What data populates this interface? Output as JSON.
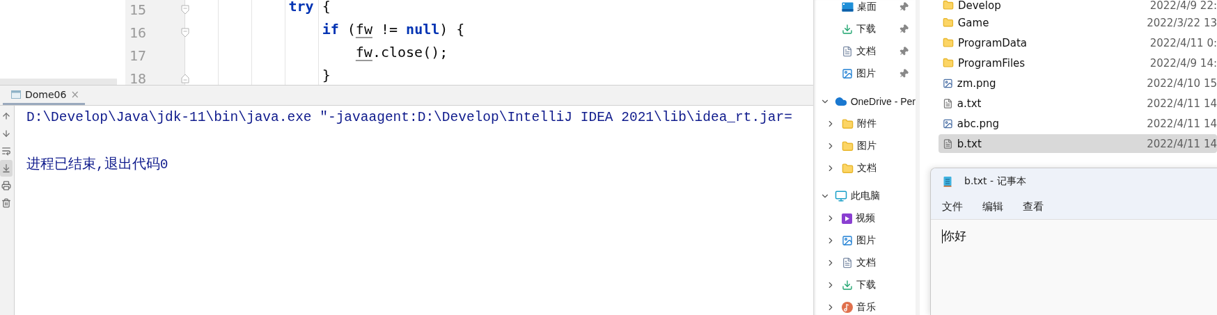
{
  "editor": {
    "lines": [
      {
        "number": "15",
        "kind": "opener",
        "tokens": [
          {
            "text": "try",
            "kind": "keyword"
          },
          {
            "text": " {",
            "kind": "plain"
          }
        ],
        "children": [
          {
            "number": "16",
            "kind": "opener",
            "tokens": [
              {
                "text": "if",
                "kind": "keyword"
              },
              {
                "text": " (",
                "kind": "plain"
              },
              {
                "text": "fw",
                "kind": "variable"
              },
              {
                "text": " != ",
                "kind": "plain"
              },
              {
                "text": "null",
                "kind": "keyword"
              },
              {
                "text": ") {",
                "kind": "plain"
              }
            ],
            "children": [
              {
                "number": "17",
                "tokens": [
                  {
                    "text": "fw",
                    "kind": "variable"
                  },
                  {
                    "text": ".close();",
                    "kind": "plain"
                  }
                ]
              }
            ]
          },
          {
            "number": "18",
            "kind": "closer",
            "tokens": [
              {
                "text": "}",
                "kind": "plain"
              }
            ]
          }
        ]
      }
    ]
  },
  "run_panel": {
    "tab": {
      "label": "Dome06",
      "close": "×",
      "selected": true
    },
    "toolbar": [
      {
        "selected": false
      },
      {
        "selected": false
      },
      {
        "selected": false
      },
      {
        "selected": true
      },
      {
        "selected": false
      },
      {
        "selected": false
      }
    ],
    "command": "D:\\Develop\\Java\\jdk-11\\bin\\java.exe \"-javaagent:D:\\Develop\\IntelliJ IDEA 2021\\lib\\idea_rt.jar=",
    "exit_message": "进程已结束,退出代码0"
  },
  "explorer": {
    "nav": [
      {
        "label": "桌面",
        "pinned": true
      },
      {
        "label": "下载",
        "pinned": true
      },
      {
        "label": "文档",
        "pinned": true
      },
      {
        "label": "图片",
        "pinned": true
      },
      {
        "label": "OneDrive - Per",
        "expanded": true,
        "children": [
          {
            "label": "附件",
            "expanded": false
          },
          {
            "label": "图片",
            "expanded": false
          },
          {
            "label": "文档",
            "expanded": false
          }
        ]
      },
      {
        "label": "此电脑",
        "expanded": true,
        "children": [
          {
            "label": "视频",
            "expanded": false
          },
          {
            "label": "图片",
            "expanded": false
          },
          {
            "label": "文档",
            "expanded": false
          },
          {
            "label": "下载",
            "expanded": false
          },
          {
            "label": "音乐",
            "expanded": false
          }
        ]
      }
    ],
    "files": [
      {
        "name": "Develop",
        "date": "2022/4/9 22:",
        "kind": "folder",
        "selected": false
      },
      {
        "name": "Game",
        "date": "2022/3/22 13",
        "kind": "folder",
        "selected": false
      },
      {
        "name": "ProgramData",
        "date": "2022/4/11 0:",
        "kind": "folder",
        "selected": false
      },
      {
        "name": "ProgramFiles",
        "date": "2022/4/9 14:",
        "kind": "folder",
        "selected": false
      },
      {
        "name": "zm.png",
        "date": "2022/4/10 15",
        "kind": "image",
        "selected": false
      },
      {
        "name": "a.txt",
        "date": "2022/4/11 14",
        "kind": "text",
        "selected": false
      },
      {
        "name": "abc.png",
        "date": "2022/4/11 14",
        "kind": "image",
        "selected": false
      },
      {
        "name": "b.txt",
        "date": "2022/4/11 14",
        "kind": "text",
        "selected": true
      }
    ]
  },
  "notepad": {
    "title": "b.txt - 记事本",
    "menu": [
      "文件",
      "编辑",
      "查看"
    ],
    "content": "你好"
  }
}
